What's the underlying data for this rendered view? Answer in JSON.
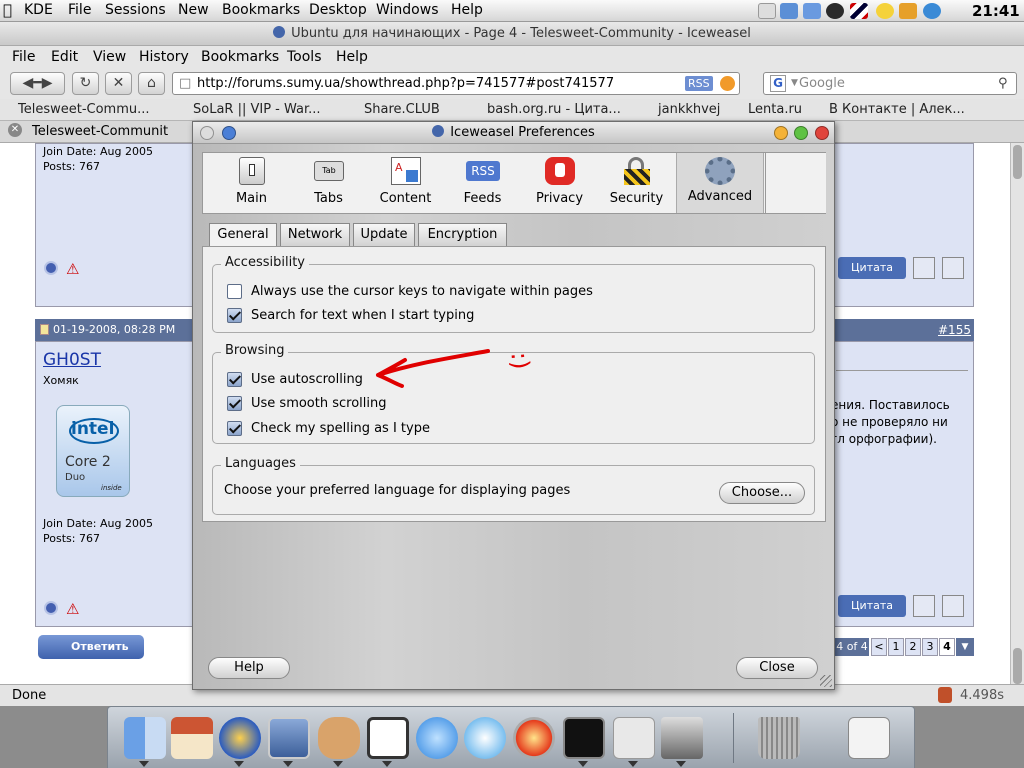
{
  "topbar": {
    "apple_icon": "apple-icon",
    "items": [
      "KDE",
      "File",
      "Sessions",
      "New",
      "Bookmarks",
      "Desktop",
      "Windows",
      "Help"
    ],
    "clock": "21:41"
  },
  "browser": {
    "title": "Ubuntu для начинающих - Page 4 - Telesweet-Community - Iceweasel",
    "menu": [
      "File",
      "Edit",
      "View",
      "History",
      "Bookmarks",
      "Tools",
      "Help"
    ],
    "url": "http://forums.sumy.ua/showthread.php?p=741577#post741577",
    "rss_badge": "RSS",
    "search_placeholder": "Google",
    "bookmarks": [
      "Telesweet-Commu...",
      "SoLaR || VIP - War...",
      "Share.CLUB",
      "bash.org.ru - Цита...",
      "jankkhvej",
      "Lenta.ru",
      "В Контакте | Алек..."
    ],
    "tab_title": "Telesweet-Communit",
    "status_left": "Done",
    "status_right": "4.498s"
  },
  "forum": {
    "post1": {
      "join": "Join Date: Aug 2005",
      "posts": "Posts: 767"
    },
    "post2": {
      "date": "01-19-2008, 08:28 PM",
      "number": "#155",
      "user": "GH0ST",
      "rank": "Хомяк",
      "cpu_brand": "intel",
      "cpu_model": "Core 2",
      "cpu_sub": "Duo",
      "cpu_inside": "inside",
      "join": "Join Date: Aug 2005",
      "posts": "Posts: 767"
    },
    "text_lines": [
      "ения. Поставилось",
      "о не проверяло ни",
      "гл орфографии)."
    ],
    "quote_label": "Цитата",
    "reply_label": "Ответить",
    "pager_label": "4 of 4",
    "pager": [
      "<",
      "1",
      "2",
      "3",
      "4"
    ]
  },
  "dialog": {
    "title": "Iceweasel Preferences",
    "panes": [
      {
        "label": "Main",
        "icon": "switch-icon"
      },
      {
        "label": "Tabs",
        "icon": "tab-icon"
      },
      {
        "label": "Content",
        "icon": "document-icon"
      },
      {
        "label": "Feeds",
        "icon": "rss-icon"
      },
      {
        "label": "Privacy",
        "icon": "stop-hand-icon"
      },
      {
        "label": "Security",
        "icon": "lock-icon"
      },
      {
        "label": "Advanced",
        "icon": "gear-icon"
      }
    ],
    "rss_icon_text": "RSS",
    "subtabs": [
      "General",
      "Network",
      "Update",
      "Encryption"
    ],
    "accessibility": {
      "legend": "Accessibility",
      "items": [
        {
          "label": "Always use the cursor keys to navigate within pages",
          "checked": false
        },
        {
          "label": "Search for text when I start typing",
          "checked": true
        }
      ]
    },
    "browsing": {
      "legend": "Browsing",
      "items": [
        {
          "label": "Use autoscrolling",
          "checked": true
        },
        {
          "label": "Use smooth scrolling",
          "checked": true
        },
        {
          "label": "Check my spelling as I type",
          "checked": true
        }
      ]
    },
    "languages": {
      "legend": "Languages",
      "desc": "Choose your preferred language for displaying pages",
      "button": "Choose..."
    },
    "help_button": "Help",
    "close_button": "Close"
  },
  "annotation": {
    "color": "#e00000",
    "smiley": ":)"
  },
  "dock": {
    "icons": [
      "finder-icon",
      "home-icon",
      "firefox-icon",
      "mail-icon",
      "rabbit-icon",
      "chat-icon",
      "video-chat-icon",
      "itunes-icon",
      "burn-icon",
      "terminal-icon",
      "tux-icon",
      "scanner-icon",
      "trash-icon",
      "window-icon"
    ]
  }
}
